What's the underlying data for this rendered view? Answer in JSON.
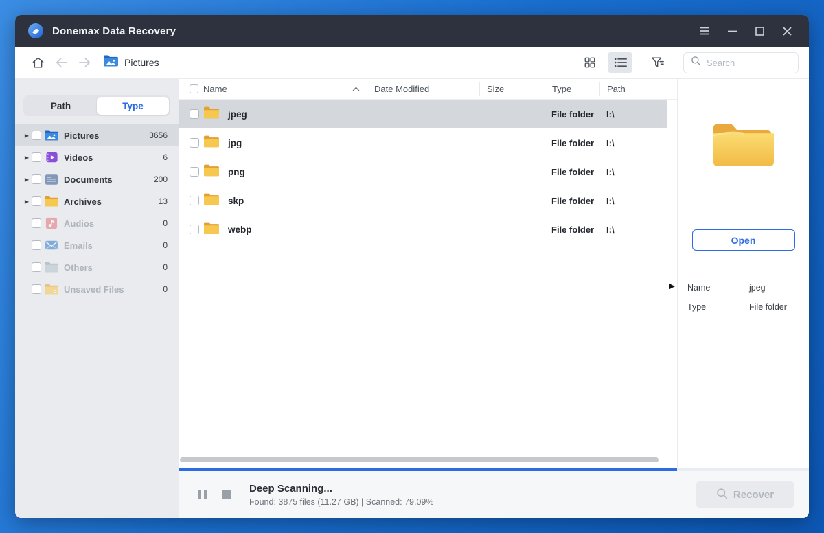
{
  "window": {
    "title": "Donemax Data Recovery"
  },
  "toolbar": {
    "breadcrumb": "Pictures",
    "search_placeholder": "Search"
  },
  "sidebar": {
    "tabs": [
      {
        "label": "Path"
      },
      {
        "label": "Type"
      }
    ],
    "items": [
      {
        "label": "Pictures",
        "count": "3656"
      },
      {
        "label": "Videos",
        "count": "6"
      },
      {
        "label": "Documents",
        "count": "200"
      },
      {
        "label": "Archives",
        "count": "13"
      },
      {
        "label": "Audios",
        "count": "0"
      },
      {
        "label": "Emails",
        "count": "0"
      },
      {
        "label": "Others",
        "count": "0"
      },
      {
        "label": "Unsaved Files",
        "count": "0"
      }
    ]
  },
  "filelist": {
    "columns": {
      "name": "Name",
      "date": "Date Modified",
      "size": "Size",
      "type": "Type",
      "path": "Path"
    },
    "rows": [
      {
        "name": "jpeg",
        "date": "",
        "size": "",
        "type": "File folder",
        "path": "I:\\"
      },
      {
        "name": "jpg",
        "date": "",
        "size": "",
        "type": "File folder",
        "path": "I:\\"
      },
      {
        "name": "png",
        "date": "",
        "size": "",
        "type": "File folder",
        "path": "I:\\"
      },
      {
        "name": "skp",
        "date": "",
        "size": "",
        "type": "File folder",
        "path": "I:\\"
      },
      {
        "name": "webp",
        "date": "",
        "size": "",
        "type": "File folder",
        "path": "I:\\"
      }
    ]
  },
  "details": {
    "open_label": "Open",
    "fields": [
      {
        "label": "Name",
        "value": "jpeg"
      },
      {
        "label": "Type",
        "value": "File folder"
      }
    ]
  },
  "statusbar": {
    "title": "Deep Scanning...",
    "detail": "Found: 3875 files (11.27 GB) | Scanned: 79.09%",
    "recover_label": "Recover",
    "progress_percent": "79.09"
  },
  "colors": {
    "accent_blue": "#2b6ce0",
    "titlebar_bg": "#2d323e",
    "folder_yellow": "#f5c14a",
    "selection_gray": "#d4d7dc"
  }
}
